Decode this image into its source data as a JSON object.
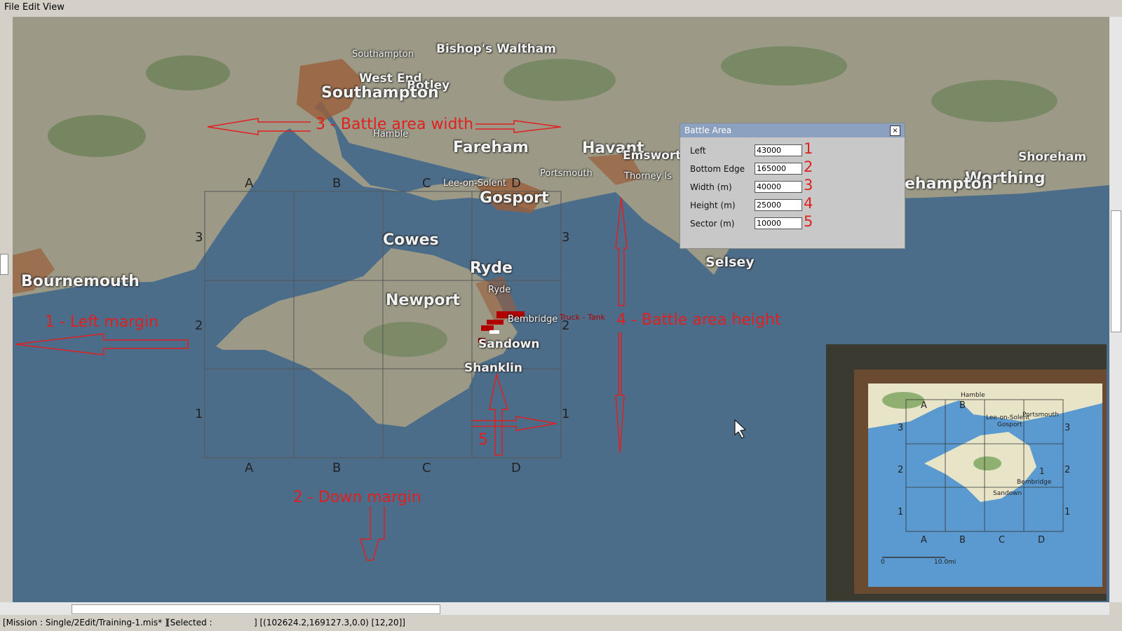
{
  "menu": {
    "file": "File",
    "edit": "Edit",
    "view": "View"
  },
  "places": {
    "southampton": "Southampton",
    "southampton_small": "Southampton",
    "bishops_waltham": "Bishop's Waltham",
    "west_end": "West End",
    "botley": "Botley",
    "hamble": "Hamble",
    "fareham": "Fareham",
    "havant": "Havant",
    "emsworth": "Emsworth",
    "portsmouth": "Portsmouth",
    "thorney": "Thorney Is",
    "lee_on_solent": "Lee-on-Solent",
    "gosport": "Gosport",
    "cowes": "Cowes",
    "ryde": "Ryde",
    "ryde_small": "Ryde",
    "newport": "Newport",
    "bournemouth": "Bournemouth",
    "sandown": "Sandown",
    "shanklin": "Shanklin",
    "bembridge": "Bembridge",
    "selsey": "Selsey",
    "worthing": "Worthing",
    "littlehampton": "ehampton",
    "shoreham": "Shoreham"
  },
  "annotations": {
    "left_margin": "1 - Left margin",
    "down_margin": "2 - Down margin",
    "width": "3 - Battle area width",
    "height": "4 - Battle area height",
    "sector": "5"
  },
  "grid": {
    "cols": [
      "A",
      "B",
      "C",
      "D"
    ],
    "rows": [
      "3",
      "2",
      "1"
    ]
  },
  "units": {
    "truck": "Truck - Tank"
  },
  "dialog": {
    "title": "Battle Area",
    "close": "×",
    "fields": [
      {
        "label": "Left",
        "value": "43000",
        "num": "1"
      },
      {
        "label": "Bottom Edge",
        "value": "165000",
        "num": "2"
      },
      {
        "label": "Width (m)",
        "value": "40000",
        "num": "3"
      },
      {
        "label": "Height (m)",
        "value": "25000",
        "num": "4"
      },
      {
        "label": "Sector (m)",
        "value": "10000",
        "num": "5"
      }
    ]
  },
  "inset": {
    "hamble": "Hamble",
    "lee_on_solent": "Lee-on-Solent",
    "gosport": "Gosport",
    "portsmouth": "Portsmouth",
    "bembridge": "Bembridge",
    "sandown": "Sandown",
    "scale_start": "0",
    "scale_end": "10.0mi",
    "cols": [
      "A",
      "B",
      "C",
      "D"
    ],
    "rows": [
      "3",
      "2",
      "1"
    ],
    "unit_num": "1"
  },
  "status": {
    "mission": "[Mission : Single/2Edit/Training-1.mis* ]",
    "selected": "[Selected :",
    "coords": "] [(102624.2,169127.3,0.0) [12,20]]"
  },
  "colors": {
    "annotation": "#e02020",
    "sea": "#4a6a86",
    "land": "#9a9a86"
  }
}
